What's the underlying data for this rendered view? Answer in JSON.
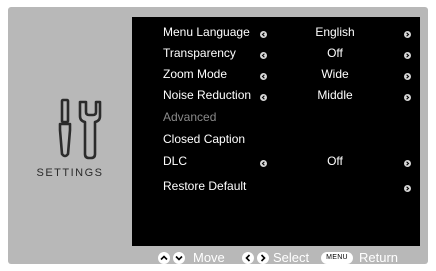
{
  "sidebar": {
    "title": "SETTINGS",
    "icon": "tools-icon"
  },
  "menu": {
    "items": [
      {
        "label": "Menu Language",
        "value": "English",
        "arrows": true
      },
      {
        "label": "Transparency",
        "value": "Off",
        "arrows": true
      },
      {
        "label": "Zoom Mode",
        "value": "Wide",
        "arrows": true
      },
      {
        "label": "Noise Reduction",
        "value": "Middle",
        "arrows": true
      },
      {
        "label": "Advanced",
        "value": "",
        "arrows": false,
        "disabled": true
      },
      {
        "label": "Closed Caption",
        "value": "",
        "arrows": false
      },
      {
        "label": "DLC",
        "value": "Off",
        "arrows": true
      },
      {
        "label": "Restore Default",
        "value": "",
        "arrows": "right-only"
      }
    ]
  },
  "help": {
    "move_label": "Move",
    "select_label": "Select",
    "menu_key": "MENU",
    "return_label": "Return"
  },
  "colors": {
    "frame": "#b8b8b8",
    "panel": "#000000",
    "text": "#ffffff",
    "disabled_text": "#8a8a8a"
  }
}
